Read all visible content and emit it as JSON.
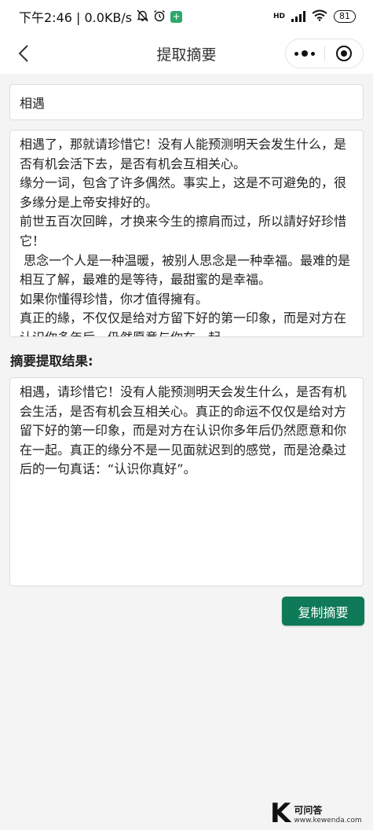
{
  "status_bar": {
    "time": "下午2:46 | 0.0KB/s",
    "network_label": "HD",
    "battery": "81"
  },
  "nav": {
    "title": "提取摘要"
  },
  "form": {
    "title_value": "相遇",
    "content_text": "相遇了，那就请珍惜它！没有人能预测明天会发生什么，是否有机会活下去，是否有机会互相关心。\n缘分一词，包含了许多偶然。事实上，这是不可避免的，很多缘分是上帝安排好的。\n前世五百次回眸，才换来今生的擦肩而过，所以請好好珍惜它！\n 思念一个人是一种温暖，被别人思念是一种幸福。最难的是相互了解，最难的是等待，最甜蜜的是幸福。\n如果你懂得珍惜，你才值得擁有。\n真正的緣，不仅仅是给对方留下好的第一印象，而是对方在认识你多年后，仍然愿意与你在一起。"
  },
  "result": {
    "label": "摘要提取结果:",
    "text": "相遇，请珍惜它！没有人能预测明天会发生什么，是否有机会生活，是否有机会互相关心。真正的命运不仅仅是给对方留下好的第一印象，而是对方在认识你多年后仍然愿意和你在一起。真正的缘分不是一见面就迟到的感觉，而是沧桑过后的一句真话：“认识你真好”。",
    "copy_button": "复制摘要"
  },
  "watermark": {
    "logo_letter": "K",
    "name": "可问答",
    "url": "www.kewenda.com"
  }
}
